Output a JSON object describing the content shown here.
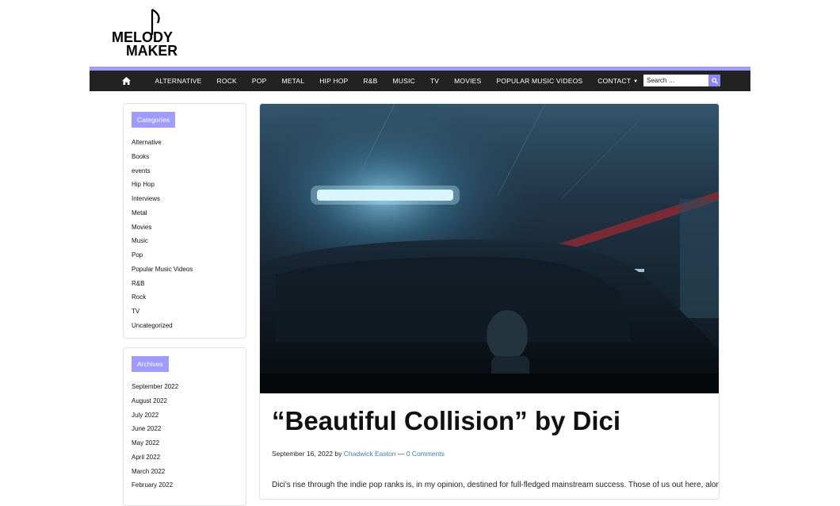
{
  "site": {
    "logo_text_line1": "MELODY",
    "logo_text_line2": "MAKER"
  },
  "nav": {
    "home_icon": "home-icon",
    "items": [
      {
        "label": "ALTERNATIVE"
      },
      {
        "label": "ROCK"
      },
      {
        "label": "POP"
      },
      {
        "label": "METAL"
      },
      {
        "label": "HIP HOP"
      },
      {
        "label": "R&B"
      },
      {
        "label": "MUSIC"
      },
      {
        "label": "TV"
      },
      {
        "label": "MOVIES"
      },
      {
        "label": "POPULAR MUSIC VIDEOS"
      },
      {
        "label": "CONTACT",
        "has_dropdown": true
      }
    ],
    "search_placeholder": "Search …",
    "search_icon": "search-icon"
  },
  "sidebar": {
    "categories": {
      "title": "Categories",
      "items": [
        "Alternative",
        "Books",
        "events",
        "Hip Hop",
        "Interviews",
        "Metal",
        "Movies",
        "Music",
        "Pop",
        "Popular Music Videos",
        "R&B",
        "Rock",
        "TV",
        "Uncategorized"
      ]
    },
    "archives": {
      "title": "Archives",
      "items": [
        "September 2022",
        "August 2022",
        "July 2022",
        "June 2022",
        "May 2022",
        "April 2022",
        "March 2022",
        "February 2022"
      ]
    }
  },
  "post": {
    "title": "“Beautiful Collision” by Dici",
    "date": "September 16, 2022",
    "by": "by",
    "author": "Chadwick Easton",
    "separator": "—",
    "comments": "0 Comments",
    "excerpt": "Dici’s rise through the indie pop ranks is, in my opinion, destined for full-fledged mainstream success. Those of us out here, along"
  },
  "colors": {
    "accent": "#9f9bff",
    "nav_bg": "#222222",
    "link": "#3d7cc2"
  }
}
